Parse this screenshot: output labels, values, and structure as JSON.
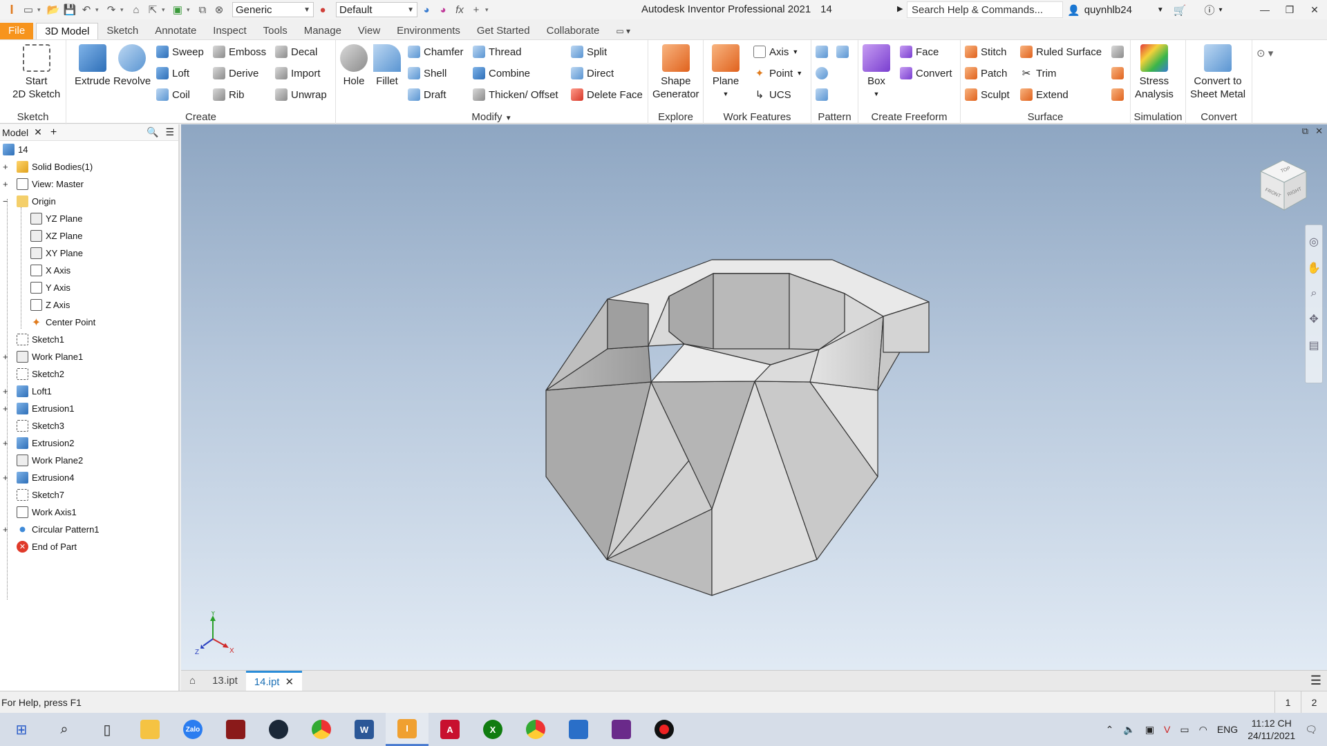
{
  "titlebar": {
    "style_combo": "Generic",
    "appearance_combo": "Default",
    "app_title": "Autodesk Inventor Professional 2021",
    "doc_name": "14",
    "search_placeholder": "Search Help & Commands...",
    "username": "quynhlb24"
  },
  "tabs": [
    "File",
    "3D Model",
    "Sketch",
    "Annotate",
    "Inspect",
    "Tools",
    "Manage",
    "View",
    "Environments",
    "Get Started",
    "Collaborate"
  ],
  "ribbon": {
    "sketch": {
      "title": "Sketch",
      "start_line1": "Start",
      "start_line2": "2D Sketch"
    },
    "create": {
      "title": "Create",
      "extrude": "Extrude",
      "revolve": "Revolve",
      "sweep": "Sweep",
      "emboss": "Emboss",
      "decal": "Decal",
      "loft": "Loft",
      "derive": "Derive",
      "import": "Import",
      "coil": "Coil",
      "rib": "Rib",
      "unwrap": "Unwrap"
    },
    "modify": {
      "title": "Modify",
      "hole": "Hole",
      "fillet": "Fillet",
      "chamfer": "Chamfer",
      "thread": "Thread",
      "split": "Split",
      "shell": "Shell",
      "combine": "Combine",
      "direct": "Direct",
      "draft": "Draft",
      "thicken": "Thicken/ Offset",
      "delete_face": "Delete Face"
    },
    "explore": {
      "title": "Explore",
      "line1": "Shape",
      "line2": "Generator"
    },
    "work": {
      "title": "Work Features",
      "plane": "Plane",
      "axis": "Axis",
      "point": "Point",
      "ucs": "UCS"
    },
    "pattern": {
      "title": "Pattern"
    },
    "freeform": {
      "title": "Create Freeform",
      "box": "Box",
      "face": "Face",
      "convert": "Convert"
    },
    "surface": {
      "title": "Surface",
      "stitch": "Stitch",
      "ruled": "Ruled Surface",
      "patch": "Patch",
      "trim": "Trim",
      "sculpt": "Sculpt",
      "extend": "Extend"
    },
    "simulation": {
      "title": "Simulation",
      "line1": "Stress",
      "line2": "Analysis"
    },
    "convert": {
      "title": "Convert",
      "line1": "Convert to",
      "line2": "Sheet Metal"
    }
  },
  "browser": {
    "tab_label": "Model",
    "root": "14",
    "nodes": [
      "Solid Bodies(1)",
      "View: Master",
      "Origin",
      "YZ Plane",
      "XZ Plane",
      "XY Plane",
      "X Axis",
      "Y Axis",
      "Z Axis",
      "Center Point",
      "Sketch1",
      "Work Plane1",
      "Sketch2",
      "Loft1",
      "Extrusion1",
      "Sketch3",
      "Extrusion2",
      "Work Plane2",
      "Extrusion4",
      "Sketch7",
      "Work Axis1",
      "Circular Pattern1",
      "End of Part"
    ]
  },
  "viewcube": {
    "top": "TOP",
    "front": "FRONT",
    "right": "RIGHT"
  },
  "triad": {
    "x": "X",
    "y": "Y",
    "z": "Z"
  },
  "doc_tabs": [
    "13.ipt",
    "14.ipt"
  ],
  "status": {
    "help": "For Help, press F1",
    "page1": "1",
    "page2": "2"
  },
  "taskbar": {
    "zalo": "Zalo",
    "tray_lang": "ENG",
    "time": "11:12 CH",
    "date": "24/11/2021"
  }
}
